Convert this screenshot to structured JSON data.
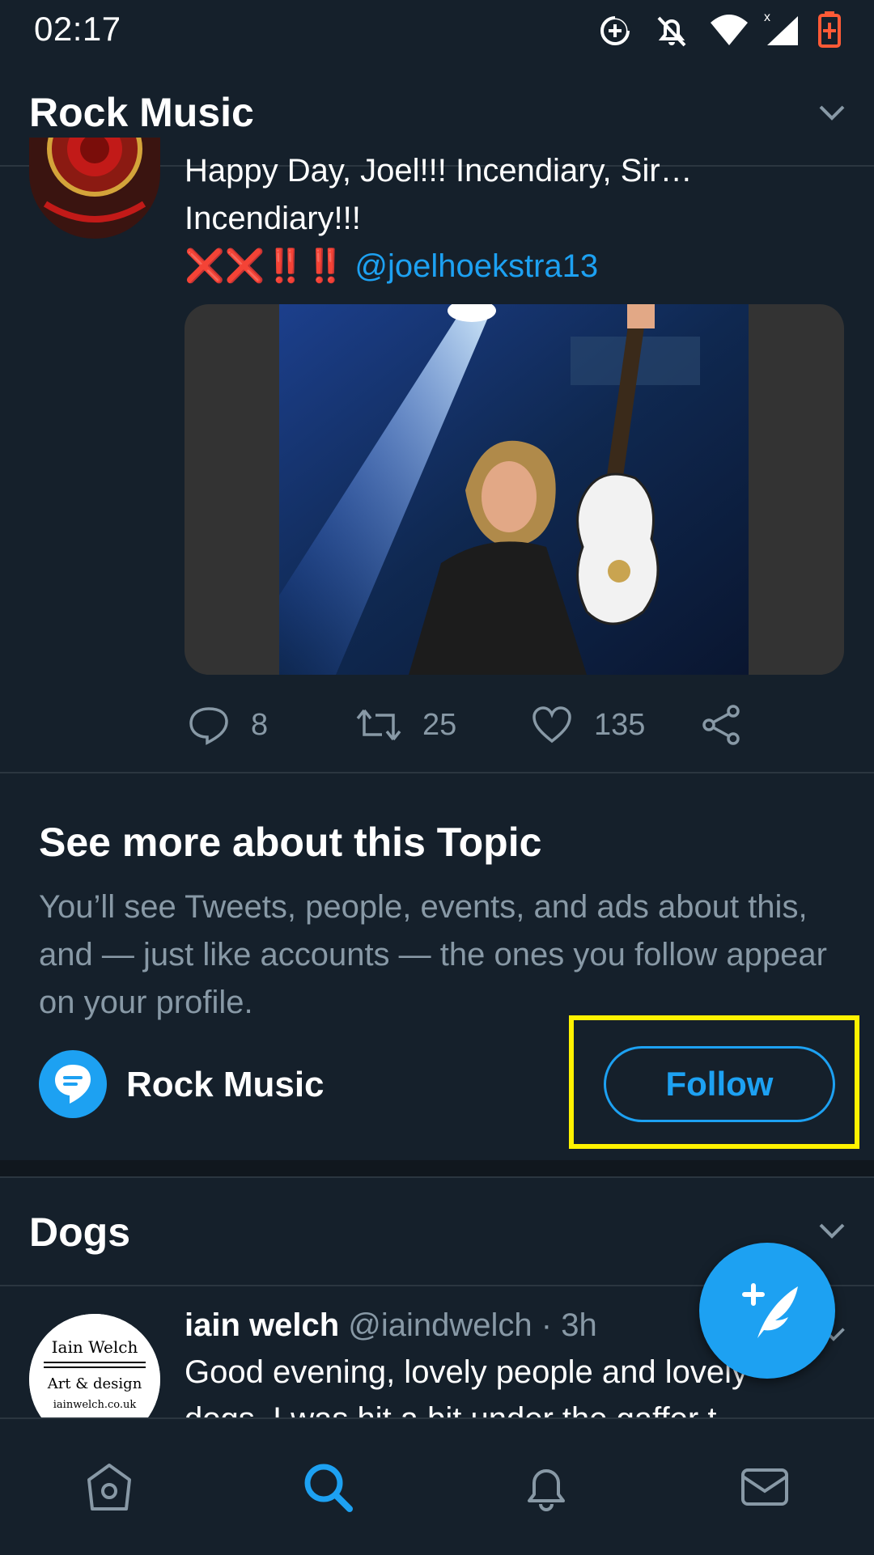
{
  "status_bar": {
    "time": "02:17",
    "icons": [
      "data-saver-icon",
      "notifications-off-icon",
      "wifi-icon",
      "signal-icon",
      "battery-icon"
    ]
  },
  "header": {
    "title": "Rock Music",
    "chevron_icon": "chevron-down-icon"
  },
  "tweet": {
    "text_line1": "Happy Day, Joel!!! Incendiary, Sir…",
    "text_line2": "Incendiary!!!",
    "symbols": "❌❌‼️‼️",
    "mention": "@joelhoekstra13",
    "actions": {
      "reply_count": "8",
      "retweet_count": "25",
      "like_count": "135"
    }
  },
  "topic_card": {
    "heading": "See more about this Topic",
    "description": "You’ll see Tweets, people, events, and ads about this, and — just like accounts — the ones you follow appear on your profile.",
    "topic_name": "Rock Music",
    "follow_label": "Follow"
  },
  "dogs_section": {
    "title": "Dogs",
    "tweet": {
      "name": "iain welch",
      "handle": "@iaindwelch · 3h",
      "text": "Good evening, lovely people and lovely",
      "text_cut": "dogs. I was hit a bit under the gaffer t"
    },
    "avatar_text": [
      "Iain Welch",
      "Art & design",
      "iainwelch.co.uk"
    ]
  },
  "colors": {
    "background": "#15202b",
    "accent": "#1da1f2",
    "secondary_text": "#8899a6",
    "highlight": "#fff200"
  },
  "bottom_nav": [
    "home-icon",
    "search-icon",
    "notifications-icon",
    "messages-icon"
  ],
  "active_nav": "search-icon"
}
